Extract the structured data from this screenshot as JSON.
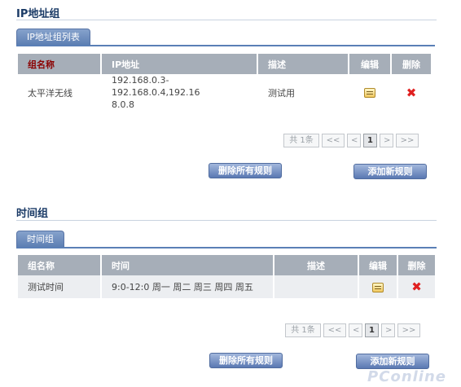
{
  "ip_group": {
    "section_title": "IP地址组",
    "tab_label": "IP地址组列表",
    "columns": [
      "组名称",
      "IP地址",
      "描述",
      "编辑",
      "删除"
    ],
    "rows": [
      {
        "name": "太平洋无线",
        "address_line1": "192.168.0.3-192.168.0.4,192.16",
        "address_line2": "8.0.8",
        "description": "测试用"
      }
    ],
    "pager": {
      "total": "共 1条",
      "first": "<<",
      "prev": "<",
      "page": "1",
      "next": ">",
      "last": ">>"
    },
    "delete_all_label": "删除所有规则",
    "add_label": "添加新规则"
  },
  "time_group": {
    "section_title": "时间组",
    "tab_label": "时间组",
    "columns": [
      "组名称",
      "时间",
      "描述",
      "编辑",
      "删除"
    ],
    "rows": [
      {
        "name": "测试时间",
        "time": "9:0-12:0 周一  周二  周三  周四  周五",
        "description": ""
      }
    ],
    "pager": {
      "total": "共 1条",
      "first": "<<",
      "prev": "<",
      "page": "1",
      "next": ">",
      "last": ">>"
    },
    "delete_all_label": "删除所有规则",
    "add_label": "添加新规则"
  },
  "watermark": "PConline",
  "colors": {
    "header_bg": "#a6aeb8",
    "accent": "#5a78b2",
    "delete_red": "#e02020",
    "title_blue": "#1a3a66"
  }
}
